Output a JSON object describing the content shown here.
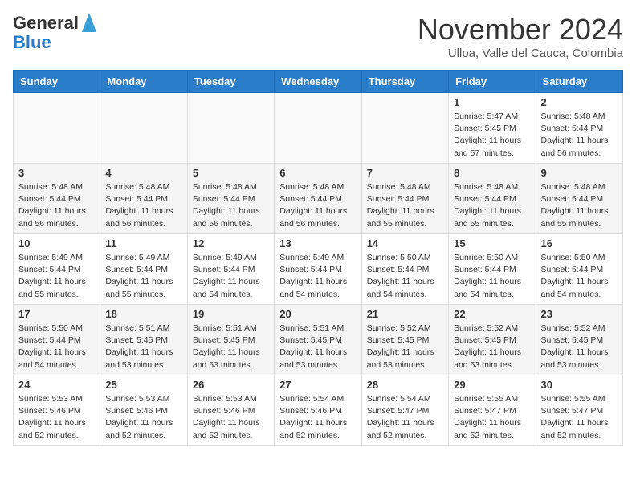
{
  "header": {
    "logo_line1": "General",
    "logo_line2": "Blue",
    "title": "November 2024",
    "subtitle": "Ulloa, Valle del Cauca, Colombia"
  },
  "days_of_week": [
    "Sunday",
    "Monday",
    "Tuesday",
    "Wednesday",
    "Thursday",
    "Friday",
    "Saturday"
  ],
  "weeks": [
    [
      {
        "day": "",
        "info": ""
      },
      {
        "day": "",
        "info": ""
      },
      {
        "day": "",
        "info": ""
      },
      {
        "day": "",
        "info": ""
      },
      {
        "day": "",
        "info": ""
      },
      {
        "day": "1",
        "info": "Sunrise: 5:47 AM\nSunset: 5:45 PM\nDaylight: 11 hours\nand 57 minutes."
      },
      {
        "day": "2",
        "info": "Sunrise: 5:48 AM\nSunset: 5:44 PM\nDaylight: 11 hours\nand 56 minutes."
      }
    ],
    [
      {
        "day": "3",
        "info": "Sunrise: 5:48 AM\nSunset: 5:44 PM\nDaylight: 11 hours\nand 56 minutes."
      },
      {
        "day": "4",
        "info": "Sunrise: 5:48 AM\nSunset: 5:44 PM\nDaylight: 11 hours\nand 56 minutes."
      },
      {
        "day": "5",
        "info": "Sunrise: 5:48 AM\nSunset: 5:44 PM\nDaylight: 11 hours\nand 56 minutes."
      },
      {
        "day": "6",
        "info": "Sunrise: 5:48 AM\nSunset: 5:44 PM\nDaylight: 11 hours\nand 56 minutes."
      },
      {
        "day": "7",
        "info": "Sunrise: 5:48 AM\nSunset: 5:44 PM\nDaylight: 11 hours\nand 55 minutes."
      },
      {
        "day": "8",
        "info": "Sunrise: 5:48 AM\nSunset: 5:44 PM\nDaylight: 11 hours\nand 55 minutes."
      },
      {
        "day": "9",
        "info": "Sunrise: 5:48 AM\nSunset: 5:44 PM\nDaylight: 11 hours\nand 55 minutes."
      }
    ],
    [
      {
        "day": "10",
        "info": "Sunrise: 5:49 AM\nSunset: 5:44 PM\nDaylight: 11 hours\nand 55 minutes."
      },
      {
        "day": "11",
        "info": "Sunrise: 5:49 AM\nSunset: 5:44 PM\nDaylight: 11 hours\nand 55 minutes."
      },
      {
        "day": "12",
        "info": "Sunrise: 5:49 AM\nSunset: 5:44 PM\nDaylight: 11 hours\nand 54 minutes."
      },
      {
        "day": "13",
        "info": "Sunrise: 5:49 AM\nSunset: 5:44 PM\nDaylight: 11 hours\nand 54 minutes."
      },
      {
        "day": "14",
        "info": "Sunrise: 5:50 AM\nSunset: 5:44 PM\nDaylight: 11 hours\nand 54 minutes."
      },
      {
        "day": "15",
        "info": "Sunrise: 5:50 AM\nSunset: 5:44 PM\nDaylight: 11 hours\nand 54 minutes."
      },
      {
        "day": "16",
        "info": "Sunrise: 5:50 AM\nSunset: 5:44 PM\nDaylight: 11 hours\nand 54 minutes."
      }
    ],
    [
      {
        "day": "17",
        "info": "Sunrise: 5:50 AM\nSunset: 5:44 PM\nDaylight: 11 hours\nand 54 minutes."
      },
      {
        "day": "18",
        "info": "Sunrise: 5:51 AM\nSunset: 5:45 PM\nDaylight: 11 hours\nand 53 minutes."
      },
      {
        "day": "19",
        "info": "Sunrise: 5:51 AM\nSunset: 5:45 PM\nDaylight: 11 hours\nand 53 minutes."
      },
      {
        "day": "20",
        "info": "Sunrise: 5:51 AM\nSunset: 5:45 PM\nDaylight: 11 hours\nand 53 minutes."
      },
      {
        "day": "21",
        "info": "Sunrise: 5:52 AM\nSunset: 5:45 PM\nDaylight: 11 hours\nand 53 minutes."
      },
      {
        "day": "22",
        "info": "Sunrise: 5:52 AM\nSunset: 5:45 PM\nDaylight: 11 hours\nand 53 minutes."
      },
      {
        "day": "23",
        "info": "Sunrise: 5:52 AM\nSunset: 5:45 PM\nDaylight: 11 hours\nand 53 minutes."
      }
    ],
    [
      {
        "day": "24",
        "info": "Sunrise: 5:53 AM\nSunset: 5:46 PM\nDaylight: 11 hours\nand 52 minutes."
      },
      {
        "day": "25",
        "info": "Sunrise: 5:53 AM\nSunset: 5:46 PM\nDaylight: 11 hours\nand 52 minutes."
      },
      {
        "day": "26",
        "info": "Sunrise: 5:53 AM\nSunset: 5:46 PM\nDaylight: 11 hours\nand 52 minutes."
      },
      {
        "day": "27",
        "info": "Sunrise: 5:54 AM\nSunset: 5:46 PM\nDaylight: 11 hours\nand 52 minutes."
      },
      {
        "day": "28",
        "info": "Sunrise: 5:54 AM\nSunset: 5:47 PM\nDaylight: 11 hours\nand 52 minutes."
      },
      {
        "day": "29",
        "info": "Sunrise: 5:55 AM\nSunset: 5:47 PM\nDaylight: 11 hours\nand 52 minutes."
      },
      {
        "day": "30",
        "info": "Sunrise: 5:55 AM\nSunset: 5:47 PM\nDaylight: 11 hours\nand 52 minutes."
      }
    ]
  ]
}
